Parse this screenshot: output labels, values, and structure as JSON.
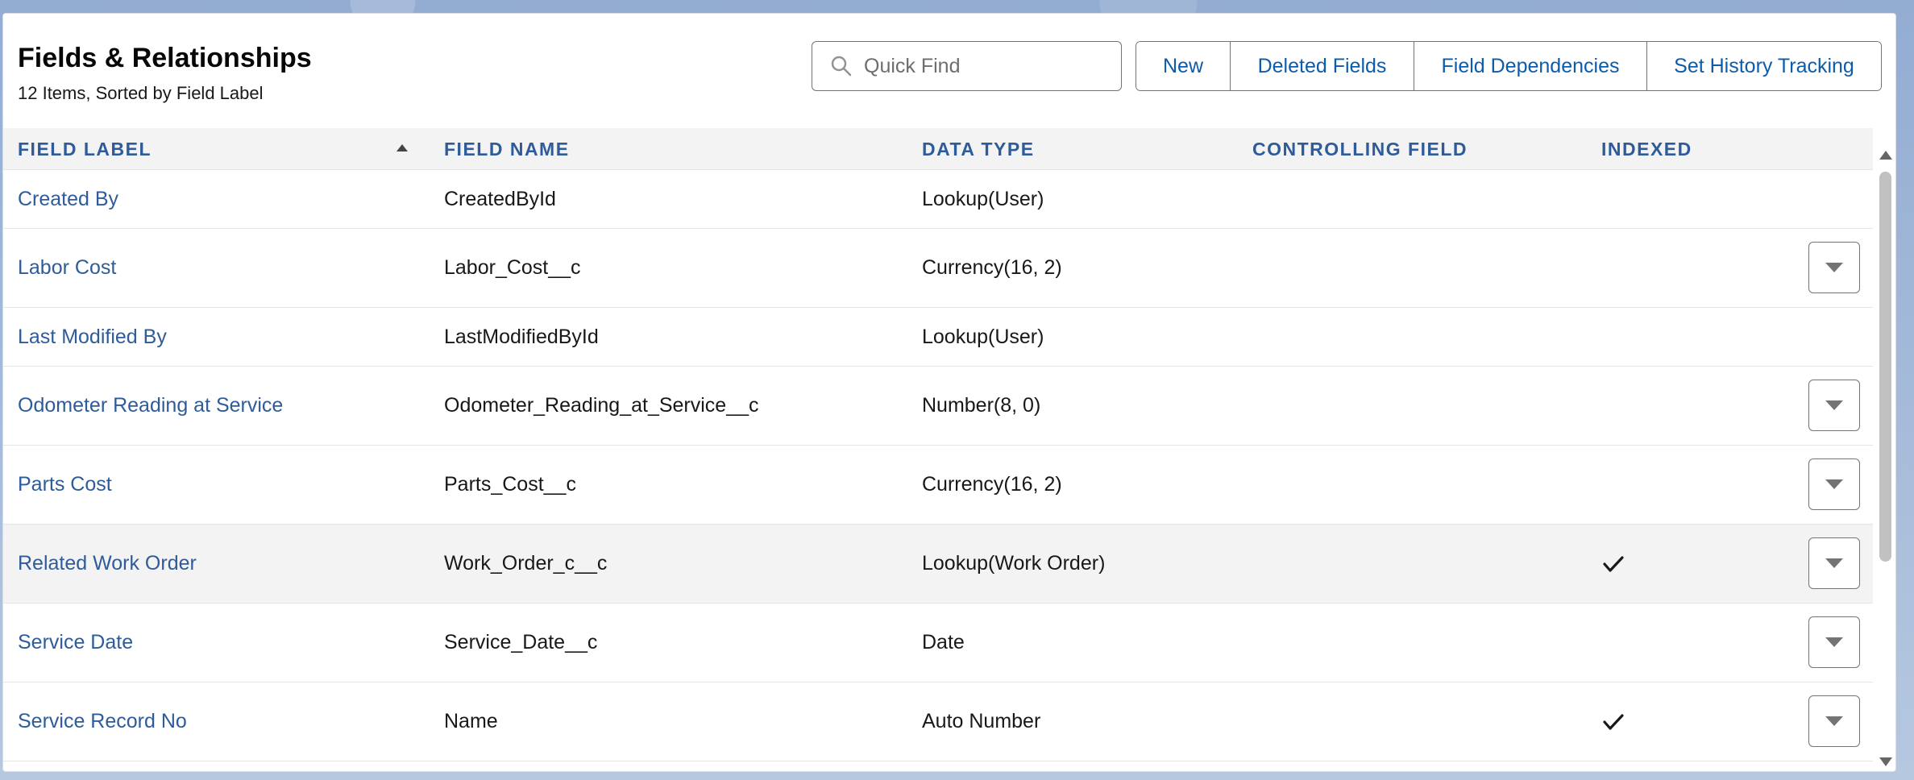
{
  "header": {
    "title": "Fields & Relationships",
    "subtitle": "12 Items, Sorted by Field Label",
    "search_placeholder": "Quick Find",
    "buttons": {
      "new": "New",
      "deleted_fields": "Deleted Fields",
      "field_dependencies": "Field Dependencies",
      "set_history_tracking": "Set History Tracking"
    }
  },
  "table": {
    "columns": {
      "field_label": "FIELD LABEL",
      "field_name": "FIELD NAME",
      "data_type": "DATA TYPE",
      "controlling_field": "CONTROLLING FIELD",
      "indexed": "INDEXED"
    },
    "rows": [
      {
        "label": "Created By",
        "name": "CreatedById",
        "type": "Lookup(User)",
        "controlling": "",
        "indexed": false,
        "action": false
      },
      {
        "label": "Labor Cost",
        "name": "Labor_Cost__c",
        "type": "Currency(16, 2)",
        "controlling": "",
        "indexed": false,
        "action": true
      },
      {
        "label": "Last Modified By",
        "name": "LastModifiedById",
        "type": "Lookup(User)",
        "controlling": "",
        "indexed": false,
        "action": false
      },
      {
        "label": "Odometer Reading at Service",
        "name": "Odometer_Reading_at_Service__c",
        "type": "Number(8, 0)",
        "controlling": "",
        "indexed": false,
        "action": true
      },
      {
        "label": "Parts Cost",
        "name": "Parts_Cost__c",
        "type": "Currency(16, 2)",
        "controlling": "",
        "indexed": false,
        "action": true
      },
      {
        "label": "Related Work Order",
        "name": "Work_Order_c__c",
        "type": "Lookup(Work Order)",
        "controlling": "",
        "indexed": true,
        "action": true,
        "highlighted": true
      },
      {
        "label": "Service Date",
        "name": "Service_Date__c",
        "type": "Date",
        "controlling": "",
        "indexed": false,
        "action": true
      },
      {
        "label": "Service Record No",
        "name": "Name",
        "type": "Auto Number",
        "controlling": "",
        "indexed": true,
        "action": true
      }
    ]
  },
  "colors": {
    "link": "#2e5c9a",
    "header_bg": "#f3f3f3",
    "highlight_row": "#f3f3f3",
    "border": "#747474"
  }
}
